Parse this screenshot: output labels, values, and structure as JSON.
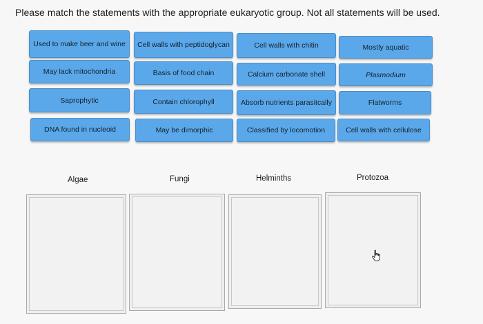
{
  "instruction": "Please match the statements with the appropriate eukaryotic group. Not all statements will be used.",
  "statements": [
    "Used to make beer and wine",
    "Cell walls with peptidoglycan",
    "Cell walls with chitin",
    "Mostly aquatic",
    "May lack mitochondria",
    "Basis of food chain",
    "Calcium carbonate shell",
    "Plasmodium",
    "Saprophytic",
    "Contain chlorophyll",
    "Absorb nutrients parasitcally",
    "Flatworms",
    "DNA found in nucleoid",
    "May be dimorphic",
    "Classified by locomotion",
    "Cell walls with cellulose"
  ],
  "groups": {
    "algae": "Algae",
    "fungi": "Fungi",
    "helminths": "Helminths",
    "protozoa": "Protozoa"
  },
  "colors": {
    "tile": "#5aa8ea",
    "tile_border": "#4a8cc7",
    "background": "#f7f7f7"
  },
  "icons": {
    "cursor": "hand-pointer-icon"
  }
}
